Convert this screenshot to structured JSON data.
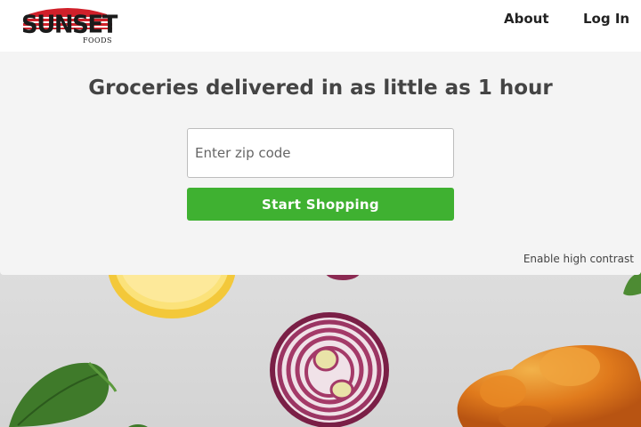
{
  "header": {
    "logo": {
      "word": "SUNSET",
      "sub": "FOODS",
      "stripe_color": "#d0202a"
    },
    "nav": {
      "about": "About",
      "login": "Log In"
    }
  },
  "hero": {
    "headline": "Groceries delivered in as little as 1 hour",
    "zip_input": {
      "value": "",
      "placeholder": "Enter zip code"
    },
    "start_button": "Start Shopping",
    "contrast_link": "Enable high contrast"
  },
  "colors": {
    "accent_green": "#3fb131",
    "hero_bg": "#f4f4f4",
    "headline_text": "#444444"
  },
  "background_image": {
    "items": [
      "lemon-slice",
      "red-onion",
      "basil-leaf",
      "orange-pepper"
    ]
  }
}
